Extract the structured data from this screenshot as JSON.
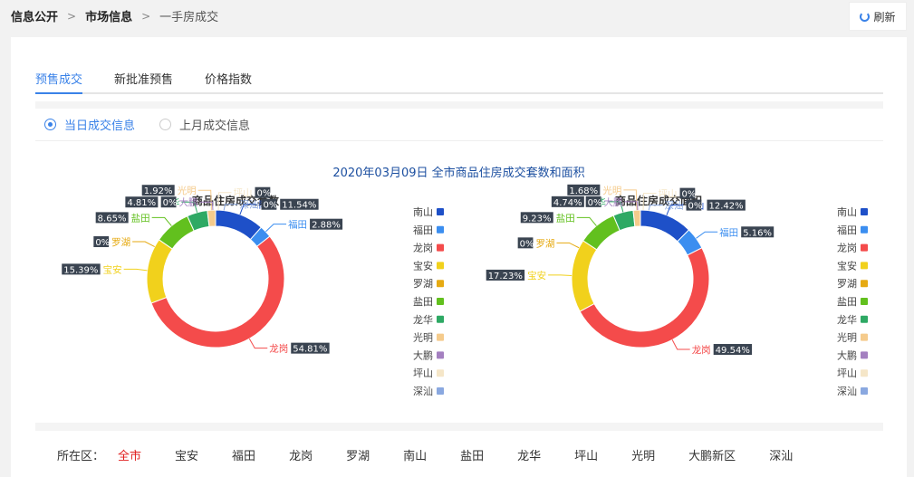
{
  "breadcrumb": {
    "items": [
      "信息公开",
      "市场信息",
      "一手房成交"
    ]
  },
  "refresh_label": "刷新",
  "tabs": [
    "预售成交",
    "新批准预售",
    "价格指数"
  ],
  "radios": [
    "当日成交信息",
    "上月成交信息"
  ],
  "main_title": "2020年03月09日 全市商品住房成交套数和面积",
  "colors": {
    "accent": "#3a82e8",
    "南山": "#1e50c8",
    "福田": "#3b8ef0",
    "龙岗": "#f44b4b",
    "宝安": "#f1d11c",
    "罗湖": "#e6aa12",
    "盐田": "#62c01e",
    "龙华": "#2ea964",
    "光明": "#f5cb8c",
    "大鹏": "#a480c0",
    "坪山": "#f5e6c8",
    "深汕": "#8aa8e0"
  },
  "legend": [
    "南山",
    "福田",
    "龙岗",
    "宝安",
    "罗湖",
    "盐田",
    "龙华",
    "光明",
    "大鹏",
    "坪山",
    "深汕"
  ],
  "chart_data": [
    {
      "type": "pie",
      "title": "商品住房成交套数",
      "categories": [
        "南山",
        "福田",
        "龙岗",
        "宝安",
        "罗湖",
        "盐田",
        "龙华",
        "光明",
        "大鹏",
        "坪山",
        "深汕"
      ],
      "values": [
        11.54,
        2.88,
        54.81,
        15.39,
        0,
        8.65,
        4.81,
        1.92,
        0,
        0,
        0
      ],
      "labels": [
        "11.54%",
        "2.88%",
        "54.81%",
        "15.39%",
        "0%",
        "8.65%",
        "4.81%",
        "1.92%",
        "0%",
        "0%",
        "0%"
      ]
    },
    {
      "type": "pie",
      "title": "商品住房成交面积",
      "categories": [
        "南山",
        "福田",
        "龙岗",
        "宝安",
        "罗湖",
        "盐田",
        "龙华",
        "光明",
        "大鹏",
        "坪山",
        "深汕"
      ],
      "values": [
        12.42,
        5.16,
        49.54,
        17.23,
        0,
        9.23,
        4.74,
        1.68,
        0,
        0,
        0
      ],
      "labels": [
        "12.42%",
        "5.16%",
        "49.54%",
        "17.23%",
        "0%",
        "9.23%",
        "4.74%",
        "1.68%",
        "0%",
        "0%",
        "0%"
      ]
    }
  ],
  "district_filter": {
    "label": "所在区：",
    "items": [
      "全市",
      "宝安",
      "福田",
      "龙岗",
      "罗湖",
      "南山",
      "盐田",
      "龙华",
      "坪山",
      "光明",
      "大鹏新区",
      "深汕"
    ],
    "selected": "全市"
  }
}
